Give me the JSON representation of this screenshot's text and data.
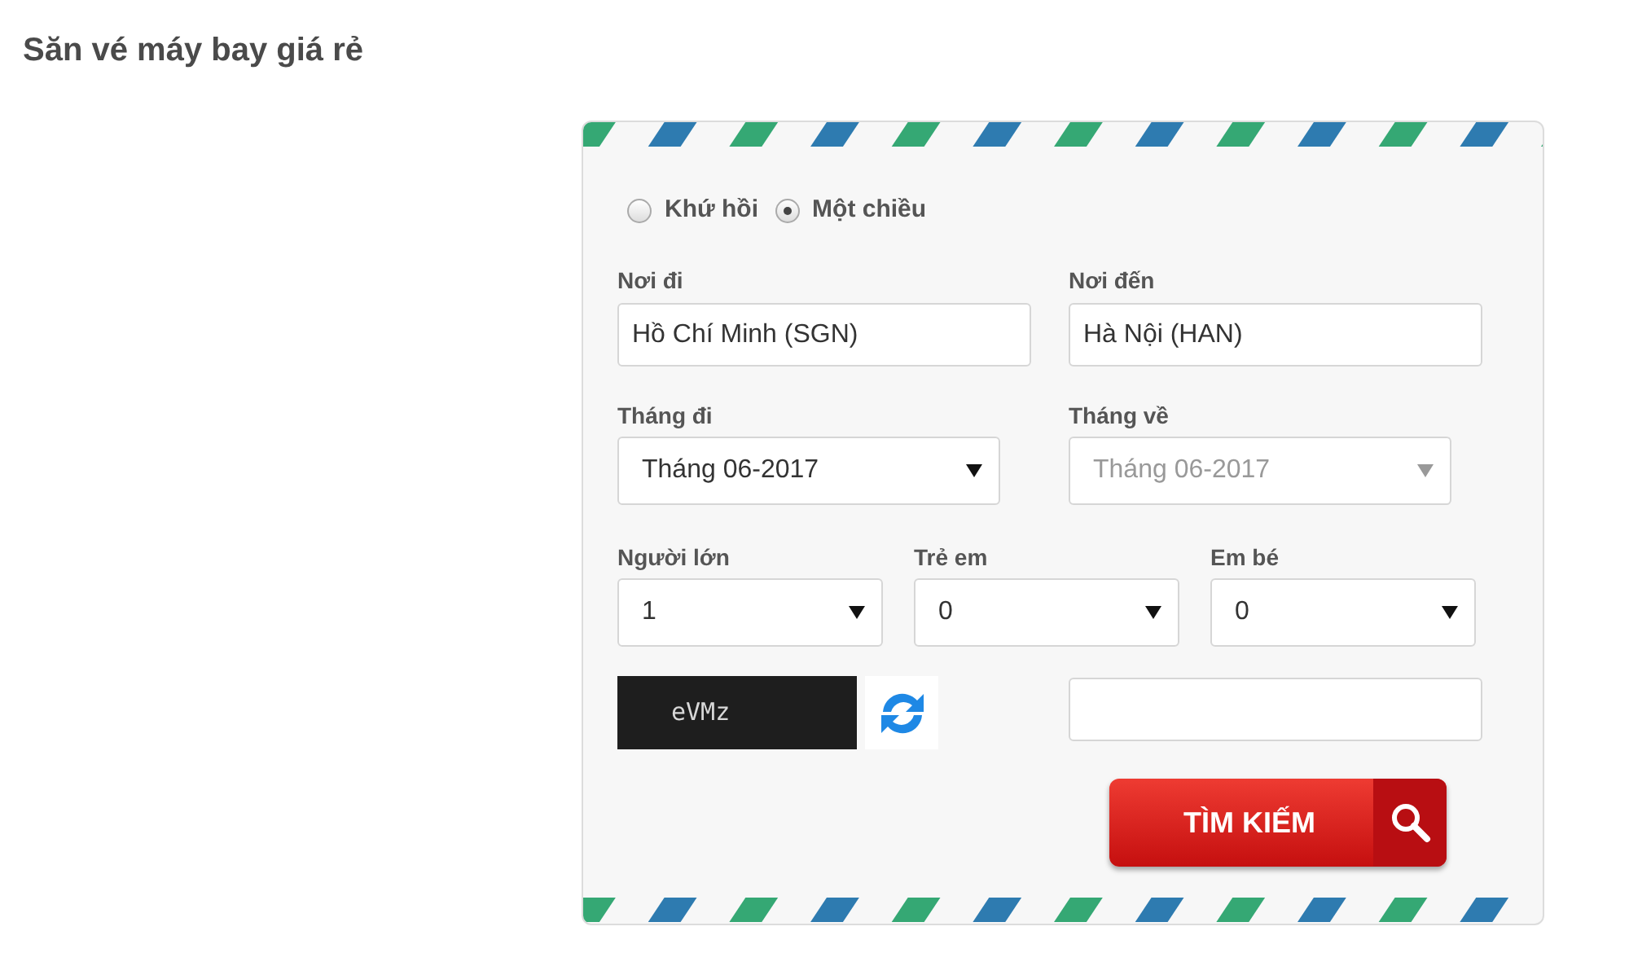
{
  "title": "Săn vé máy bay giá rẻ",
  "trip_types": [
    {
      "label": "Khứ hồi",
      "selected": false
    },
    {
      "label": "Một chiều",
      "selected": true
    }
  ],
  "places": [
    {
      "label": "Nơi đi",
      "value": "Hồ Chí Minh (SGN)"
    },
    {
      "label": "Nơi đến",
      "value": "Hà Nội (HAN)"
    }
  ],
  "months": [
    {
      "label": "Tháng đi",
      "value": "Tháng 06-2017",
      "disabled": false
    },
    {
      "label": "Tháng về",
      "value": "Tháng 06-2017",
      "disabled": true
    }
  ],
  "passengers": [
    {
      "label": "Người lớn",
      "value": "1"
    },
    {
      "label": "Trẻ em",
      "value": "0"
    },
    {
      "label": "Em bé",
      "value": "0"
    }
  ],
  "captcha": {
    "code": "eVMz"
  },
  "search_button": {
    "label": "TÌM KIẾM"
  }
}
